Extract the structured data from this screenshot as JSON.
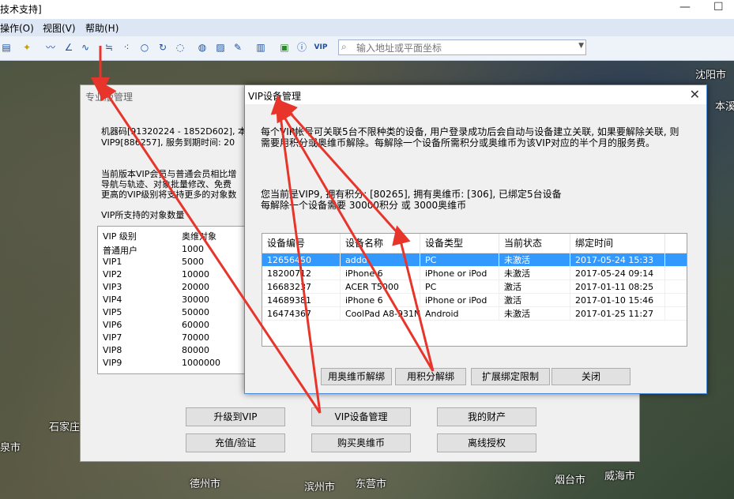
{
  "app": {
    "title": "技术支持]"
  },
  "menu": {
    "items": [
      "操作(O)",
      "视图(V)",
      "帮助(H)"
    ]
  },
  "toolbar": {
    "vip_label": "VIP",
    "search_placeholder": "输入地址或平面坐标"
  },
  "map_labels": [
    "沈阳市",
    "本溪",
    "石家庄",
    "泉市",
    "德州市",
    "滨州市",
    "东营市",
    "烟台市",
    "威海市"
  ],
  "pro_window": {
    "title": "专业版管理",
    "info_lines": [
      "机器码[91320224 - 1852D602], 本",
      "VIP9[886257], 服务到期时间: 20",
      "",
      "当前版本VIP会员与普通会员相比增",
      "导航与轨迹、对象批量修改、免费",
      "更高的VIP级别将支持更多的对象数"
    ],
    "table_caption": "VIP所支持的对象数量",
    "table_headers": [
      "VIP 级别",
      "奥维对象"
    ],
    "table_rows": [
      [
        "普通用户",
        "1000"
      ],
      [
        "VIP1",
        "5000"
      ],
      [
        "VIP2",
        "10000"
      ],
      [
        "VIP3",
        "20000"
      ],
      [
        "VIP4",
        "30000"
      ],
      [
        "VIP5",
        "50000"
      ],
      [
        "VIP6",
        "60000"
      ],
      [
        "VIP7",
        "70000"
      ],
      [
        "VIP8",
        "80000"
      ],
      [
        "VIP9",
        "1000000"
      ]
    ],
    "buttons": [
      "升级到VIP",
      "VIP设备管理",
      "我的财产",
      "充值/验证",
      "购买奥维币",
      "离线授权"
    ]
  },
  "vip_window": {
    "title": "VIP设备管理",
    "desc_lines": [
      "每个VIP帐号可关联5台不限种类的设备, 用户登录成功后会自动与设备建立关联, 如果要解除关联, 则",
      "需要用积分或奥维币解除。每解除一个设备所需积分或奥维币为该VIP对应的半个月的服务费。"
    ],
    "status_lines": [
      "您当前是VIP9, 拥有积分: [80265], 拥有奥维币: [306], 已绑定5台设备",
      "每解除一个设备需要 30000积分 或 3000奥维币"
    ],
    "table_headers": [
      "设备编号",
      "设备名称",
      "设备类型",
      "当前状态",
      "绑定时间"
    ],
    "table_rows": [
      [
        "12656450",
        "addd",
        "PC",
        "未激活",
        "2017-05-24 15:33"
      ],
      [
        "18200712",
        "iPhone 6",
        "iPhone or iPod",
        "未激活",
        "2017-05-24 09:14"
      ],
      [
        "16683237",
        "ACER T5000",
        "PC",
        "激活",
        "2017-01-11 08:25"
      ],
      [
        "14689381",
        "iPhone 6",
        "iPhone or iPod",
        "激活",
        "2017-01-10 15:46"
      ],
      [
        "16474367",
        "CoolPad A8-931N",
        "Android",
        "未激活",
        "2017-01-25 11:27"
      ]
    ],
    "selected_row": 0,
    "buttons": [
      "用奥维币解绑",
      "用积分解绑",
      "扩展绑定限制",
      "关闭"
    ]
  },
  "colors": {
    "selection": "#3399ff",
    "annotation_arrow": "#e8352b"
  }
}
